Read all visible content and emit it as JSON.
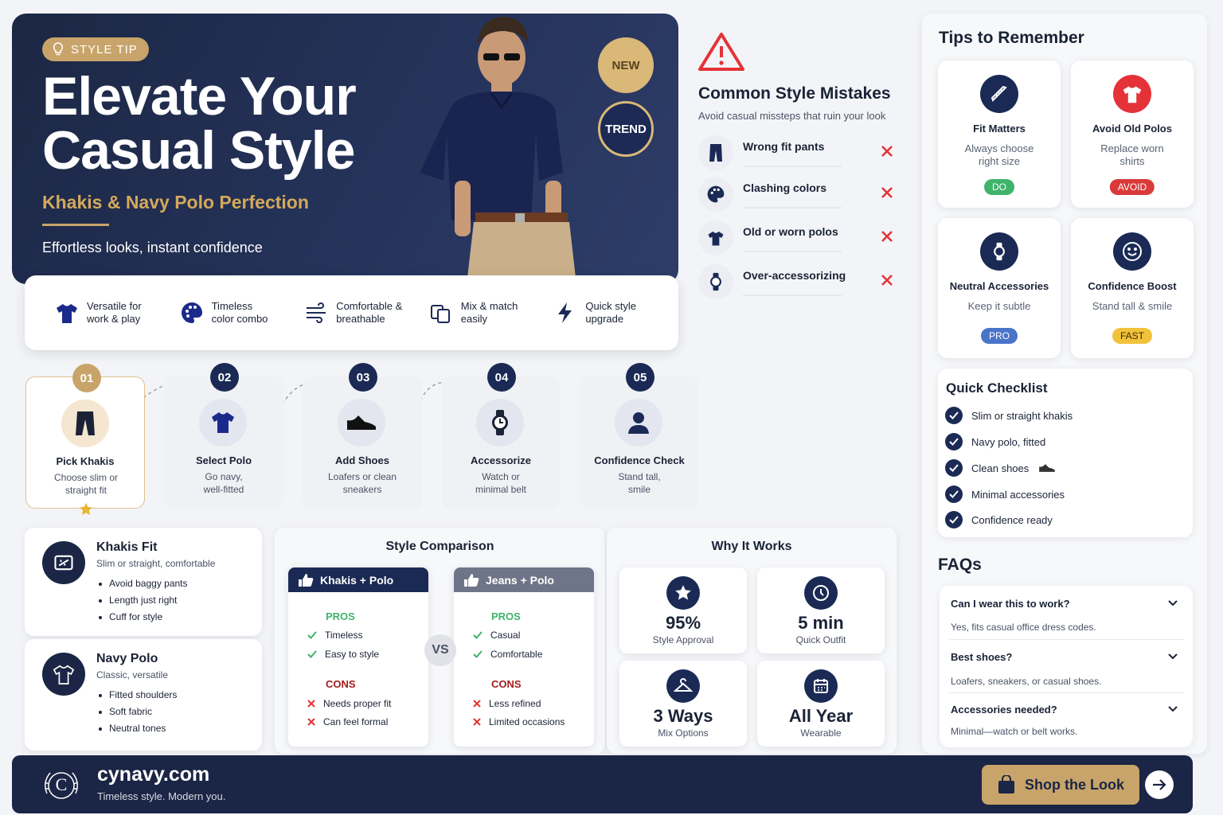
{
  "hero": {
    "badge": "STYLE TIP",
    "title_line1": "Elevate Your",
    "title_line2": "Casual Style",
    "subtitle": "Khakis & Navy Polo Perfection",
    "tagline": "Effortless looks, instant confidence",
    "circle_new": "NEW",
    "circle_trend": "TREND"
  },
  "features": [
    {
      "icon": "shirt-icon",
      "l1": "Versatile for",
      "l2": "work & play"
    },
    {
      "icon": "palette-icon",
      "l1": "Timeless",
      "l2": "color combo"
    },
    {
      "icon": "wind-icon",
      "l1": "Comfortable &",
      "l2": "breathable"
    },
    {
      "icon": "copy-icon",
      "l1": "Mix & match",
      "l2": "easily"
    },
    {
      "icon": "bolt-icon",
      "l1": "Quick style",
      "l2": "upgrade"
    }
  ],
  "steps": [
    {
      "num": "01",
      "title": "Pick Khakis",
      "d1": "Choose slim or",
      "d2": "straight fit",
      "icon": "pants-icon"
    },
    {
      "num": "02",
      "title": "Select Polo",
      "d1": "Go navy,",
      "d2": "well-fitted",
      "icon": "polo-icon"
    },
    {
      "num": "03",
      "title": "Add Shoes",
      "d1": "Loafers or clean",
      "d2": "sneakers",
      "icon": "shoe-icon"
    },
    {
      "num": "04",
      "title": "Accessorize",
      "d1": "Watch or",
      "d2": "minimal belt",
      "icon": "watch-icon"
    },
    {
      "num": "05",
      "title": "Confidence Check",
      "d1": "Stand tall,",
      "d2": "smile",
      "icon": "person-icon"
    }
  ],
  "mistakes": {
    "title": "Common Style Mistakes",
    "subtitle": "Avoid casual missteps that ruin your look",
    "items": [
      "Wrong fit pants",
      "Clashing colors",
      "Old or worn polos",
      "Over-accessorizing"
    ]
  },
  "tips": {
    "title": "Tips to Remember",
    "cards": [
      {
        "title": "Fit Matters",
        "d1": "Always choose",
        "d2": "right size",
        "pill": "DO",
        "pill_color": "#3fb36a",
        "icon_bg": "#1b2a55",
        "icon": "ruler-icon"
      },
      {
        "title": "Avoid Old Polos",
        "d1": "Replace worn",
        "d2": "shirts",
        "pill": "AVOID",
        "pill_color": "#d93a3a",
        "icon_bg": "#e53238",
        "icon": "shirt-icon"
      },
      {
        "title": "Neutral Accessories",
        "d1": "Keep it subtle",
        "d2": "",
        "pill": "PRO",
        "pill_color": "#4a74c9",
        "icon_bg": "#1b2a55",
        "icon": "watch-icon"
      },
      {
        "title": "Confidence Boost",
        "d1": "Stand tall & smile",
        "d2": "",
        "pill": "FAST",
        "pill_color": "#f2c23a",
        "icon_bg": "#1b2a55",
        "icon": "smile-icon"
      }
    ]
  },
  "checklist": {
    "title": "Quick Checklist",
    "items": [
      "Slim or straight khakis",
      "Navy polo, fitted",
      "Clean shoes",
      "Minimal accessories",
      "Confidence ready"
    ]
  },
  "faqs": {
    "title": "FAQs",
    "items": [
      {
        "q": "Can I wear this to work?",
        "a": "Yes, fits casual office dress codes."
      },
      {
        "q": "Best shoes?",
        "a": "Loafers, sneakers, or casual shoes."
      },
      {
        "q": "Accessories needed?",
        "a": "Minimal—watch or belt works."
      }
    ]
  },
  "fit": {
    "khakis": {
      "title": "Khakis Fit",
      "sub": "Slim or straight, comfortable",
      "bullets": [
        "Avoid baggy pants",
        "Length just right",
        "Cuff for style"
      ]
    },
    "polo": {
      "title": "Navy Polo",
      "sub": "Classic, versatile",
      "bullets": [
        "Fitted shoulders",
        "Soft fabric",
        "Neutral tones"
      ]
    }
  },
  "comparison": {
    "title": "Style Comparison",
    "vs": "VS",
    "left": {
      "title": "Khakis + Polo",
      "pros_label": "PROS",
      "pros": [
        "Timeless",
        "Easy to style"
      ],
      "cons_label": "CONS",
      "cons": [
        "Needs proper fit",
        "Can feel formal"
      ]
    },
    "right": {
      "title": "Jeans + Polo",
      "pros_label": "PROS",
      "pros": [
        "Casual",
        "Comfortable"
      ],
      "cons_label": "CONS",
      "cons": [
        "Less refined",
        "Limited occasions"
      ]
    }
  },
  "why": {
    "title": "Why It Works",
    "stats": [
      {
        "value": "95%",
        "label": "Style Approval",
        "icon": "star-icon"
      },
      {
        "value": "5 min",
        "label": "Quick Outfit",
        "icon": "clock-icon"
      },
      {
        "value": "3 Ways",
        "label": "Mix Options",
        "icon": "hanger-icon"
      },
      {
        "value": "All Year",
        "label": "Wearable",
        "icon": "calendar-icon"
      }
    ]
  },
  "footer": {
    "logo_letter": "C",
    "site": "cynavy.com",
    "slogan": "Timeless style. Modern you.",
    "cta": "Shop the Look"
  },
  "colors": {
    "navy": "#1b2a55",
    "gold": "#c8a46a",
    "red": "#e53238",
    "green": "#3fb36a"
  }
}
